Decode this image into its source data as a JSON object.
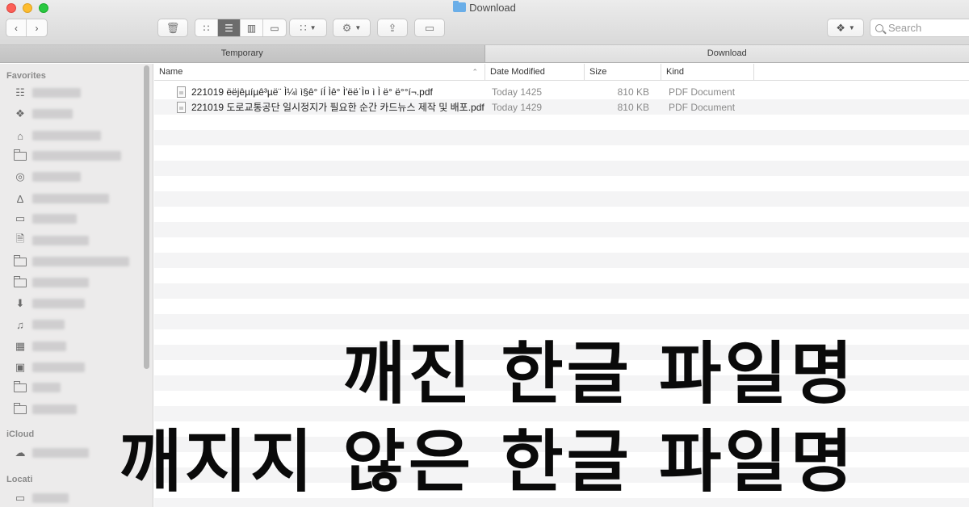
{
  "window": {
    "title": "Download"
  },
  "toolbar": {
    "search_placeholder": "Search",
    "view_modes": [
      "icon",
      "list",
      "column",
      "gallery"
    ],
    "active_view": "list"
  },
  "tabs": [
    {
      "label": "Temporary",
      "active": false
    },
    {
      "label": "Download",
      "active": true
    }
  ],
  "sidebar": {
    "favorites_header": "Favorites",
    "icloud_header": "iCloud",
    "locations_header": "Locati"
  },
  "columns": {
    "name": "Name",
    "date": "Date Modified",
    "size": "Size",
    "kind": "Kind"
  },
  "files": [
    {
      "name": "221019 ëëjêµíµê³µë¨  Ì¼ì ì§ê° íÍ Ìê° Ì'ëëˈÌ¤ ì Ì ë° ë°°í¬.pdf",
      "date": "Today 1425",
      "size": "810 KB",
      "kind": "PDF Document"
    },
    {
      "name": "221019 도로교통공단  일시정지가 필요한 순간 카드뉴스 제작 및 배포.pdf",
      "date": "Today 1429",
      "size": "810 KB",
      "kind": "PDF Document"
    }
  ],
  "overlay": {
    "line1": "깨진 한글 파일명",
    "line2": "깨지지 않은 한글 파일명"
  },
  "colors": {
    "accent_folder": "#6aaee8",
    "overlay_text": "#0a0a0a"
  }
}
